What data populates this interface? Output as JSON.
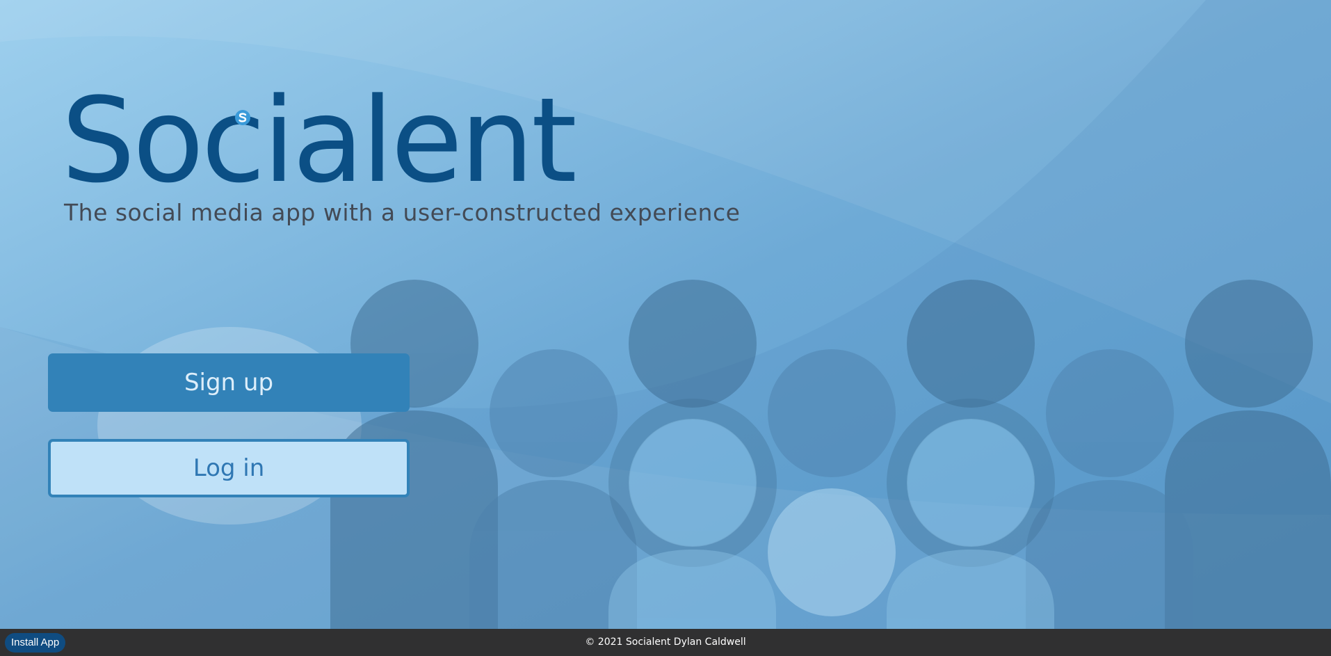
{
  "brand": {
    "name": "Socialent",
    "tagline": "The social media app with a user-constructed experience"
  },
  "actions": {
    "signup_label": "Sign up",
    "login_label": "Log in"
  },
  "footer": {
    "install_label": "Install App",
    "copyright": "© 2021 Socialent Dylan Caldwell"
  },
  "icons": {
    "logo_mark": "socialent-s-icon"
  },
  "colors": {
    "brand": "#0b4f85",
    "button_primary": "#3282b8",
    "button_secondary_bg": "#bfe1f8",
    "footer_bg": "#303031"
  }
}
